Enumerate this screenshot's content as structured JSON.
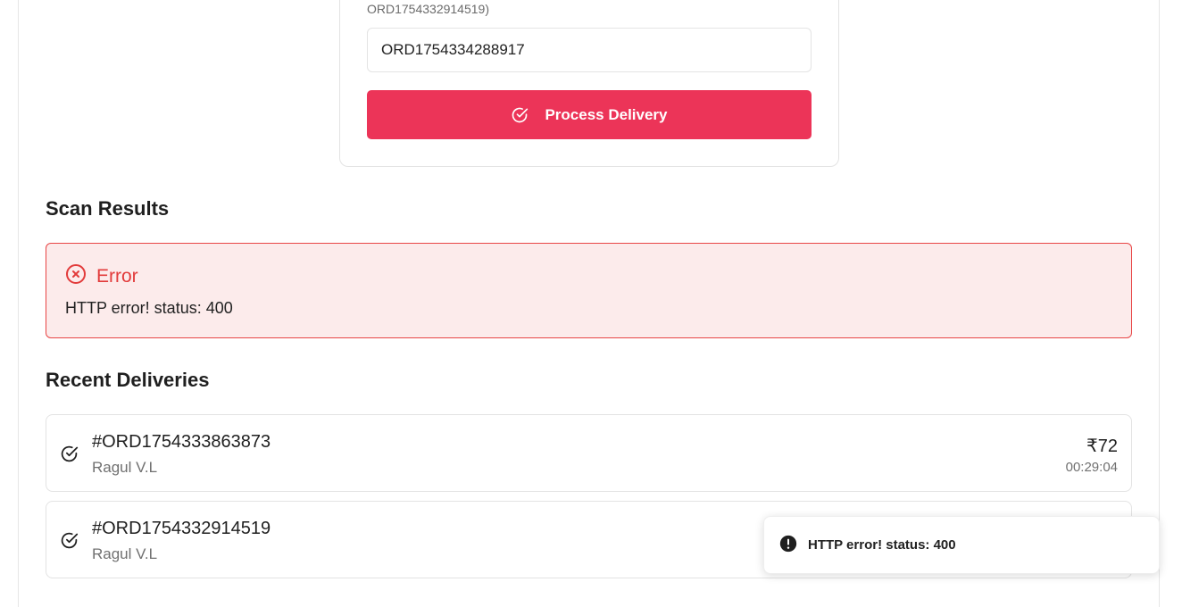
{
  "scan_form": {
    "hint_text": "ORD1754332914519)",
    "order_input_value": "ORD1754334288917",
    "process_button_label": "Process Delivery"
  },
  "scan_results": {
    "title": "Scan Results",
    "error_title": "Error",
    "error_message": "HTTP error! status: 400"
  },
  "recent_deliveries": {
    "title": "Recent Deliveries",
    "items": [
      {
        "order_id": "#ORD1754333863873",
        "customer": "Ragul V.L",
        "amount": "₹72",
        "time": "00:29:04"
      },
      {
        "order_id": "#ORD1754332914519",
        "customer": "Ragul V.L",
        "amount": "",
        "time": ""
      }
    ]
  },
  "toast": {
    "message": "HTTP error! status: 400"
  },
  "colors": {
    "accent": "#ec3458",
    "error_text": "#e23b3b",
    "error_bg": "#fcebeb",
    "error_border": "#e84545"
  },
  "icons": {
    "process_button": "check-circle-icon",
    "error": "x-circle-icon",
    "delivery_item": "check-circle-icon",
    "toast": "alert-circle-icon"
  }
}
